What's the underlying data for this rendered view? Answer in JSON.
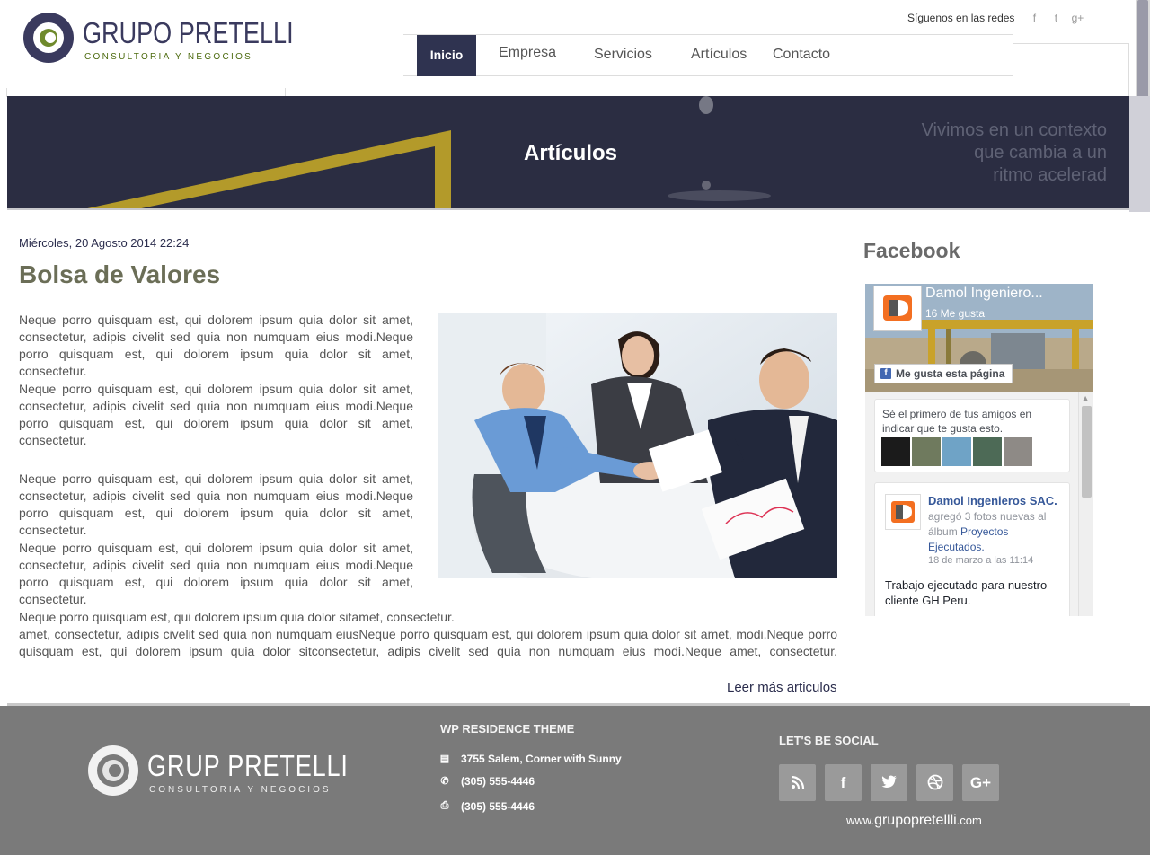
{
  "header": {
    "logo_name": "GRUPO PRETELLI",
    "logo_tagline": "CONSULTORIA Y NEGOCIOS",
    "social_label": "Síguenos en las redes",
    "social_icons": [
      "facebook-icon",
      "twitter-icon",
      "google-plus-icon"
    ],
    "social_glyphs": [
      "f",
      "t",
      "g+"
    ]
  },
  "nav": {
    "items": [
      {
        "label": "Inicio",
        "active": true
      },
      {
        "label": "Empresa",
        "active": false
      },
      {
        "label": "Servicios",
        "active": false
      },
      {
        "label": "Artículos",
        "active": false
      },
      {
        "label": "Contacto",
        "active": false
      }
    ]
  },
  "banner": {
    "title": "Artículos",
    "quote_lines": [
      "Vivimos en un contexto",
      "que cambia a un",
      "ritmo acelerad"
    ]
  },
  "post": {
    "date": "Miércoles, 20 Agosto 2014 22:24",
    "title": "Bolsa de Valores",
    "paragraphs": [
      "Neque porro quisquam est, qui dolorem ipsum quia dolor sit amet, consectetur, adipis civelit sed quia non numquam eius modi.Neque porro quisquam est, qui dolorem ipsum quia dolor sit amet, consectetur.",
      "Neque porro quisquam est, qui dolorem ipsum quia dolor sit amet, consectetur, adipis civelit sed quia non numquam eius modi.Neque porro quisquam est, qui dolorem ipsum quia dolor sit amet, consectetur.",
      "Neque porro quisquam est, qui dolorem ipsum quia dolor sit amet, consectetur, adipis civelit sed quia non numquam eius modi.Neque porro quisquam est, qui dolorem ipsum quia dolor sit amet, consectetur.",
      "Neque porro quisquam est, qui dolorem ipsum quia dolor sit amet, consectetur, adipis civelit sed quia non numquam eius modi.Neque porro quisquam est, qui dolorem ipsum quia dolor sit amet, consectetur."
    ],
    "last_line_1": "Neque porro quisquam est, qui dolorem ipsum quia dolor sitamet, consectetur.",
    "last_paragraph": "amet, consectetur, adipis civelit sed quia non numquam eiusNeque porro quisquam est, qui dolorem ipsum quia dolor sit amet, modi.Neque porro quisquam est, qui dolorem ipsum quia dolor sitconsectetur, adipis civelit sed quia non numquam eius modi.Neque amet, consectetur.",
    "read_more": "Leer más articulos"
  },
  "sidebar": {
    "facebook_heading": "Facebook",
    "page_name": "Damol Ingeniero...",
    "likes": "16 Me gusta",
    "like_button": "Me gusta esta página",
    "friends_prompt": "Sé el primero de tus amigos en indicar que te gusta esto.",
    "post_author": "Damol Ingenieros SAC.",
    "post_action": "agregó 3 fotos nuevas al álbum",
    "post_album": "Proyectos Ejecutados.",
    "post_time": "18 de marzo a las 11:14",
    "post_body": "Trabajo ejecutado para nuestro cliente GH Peru."
  },
  "footer": {
    "logo_name": "GRUP PRETELLI",
    "logo_tagline": "CONSULTORIA Y NEGOCIOS",
    "col1_title": "WP RESIDENCE THEME",
    "address": "3755 Salem, Corner with Sunny",
    "phone": "(305) 555-4446",
    "fax": "(305) 555-4446",
    "col2_title": "LET'S BE SOCIAL",
    "social_buttons": [
      "rss-icon",
      "facebook-icon",
      "twitter-icon",
      "dribbble-icon",
      "google-plus-icon"
    ],
    "url_prefix": "www.",
    "url_main": "grupopretellli",
    "url_suffix": ".com"
  },
  "colors": {
    "nav_active": "#2f3350",
    "banner_bg": "#2b2d42",
    "banner_gold": "#b39a2a",
    "title_olive": "#6b6e57",
    "footer_bg": "#7a7a7a",
    "facebook_blue": "#4267b2"
  }
}
